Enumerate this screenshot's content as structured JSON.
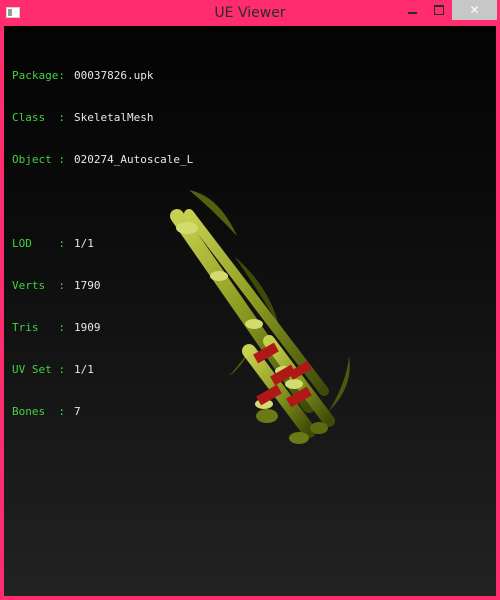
{
  "window": {
    "title": "UE Viewer",
    "close_glyph": "✕"
  },
  "info": {
    "package": {
      "label": "Package:",
      "value": "00037826.upk"
    },
    "class": {
      "label": "Class  :",
      "value": "SkeletalMesh"
    },
    "object": {
      "label": "Object :",
      "value": "020274_Autoscale_L"
    },
    "lod": {
      "label": "LOD    :",
      "value": "1/1"
    },
    "verts": {
      "label": "Verts  :",
      "value": "1790"
    },
    "tris": {
      "label": "Tris   :",
      "value": "1909"
    },
    "uvset": {
      "label": "UV Set :",
      "value": "1/1"
    },
    "bones": {
      "label": "Bones  :",
      "value": "7"
    }
  },
  "colors": {
    "frame": "#ff2d6f",
    "label_green": "#41d241",
    "mesh_green": "#9aa82a",
    "binding_red": "#b01818"
  }
}
